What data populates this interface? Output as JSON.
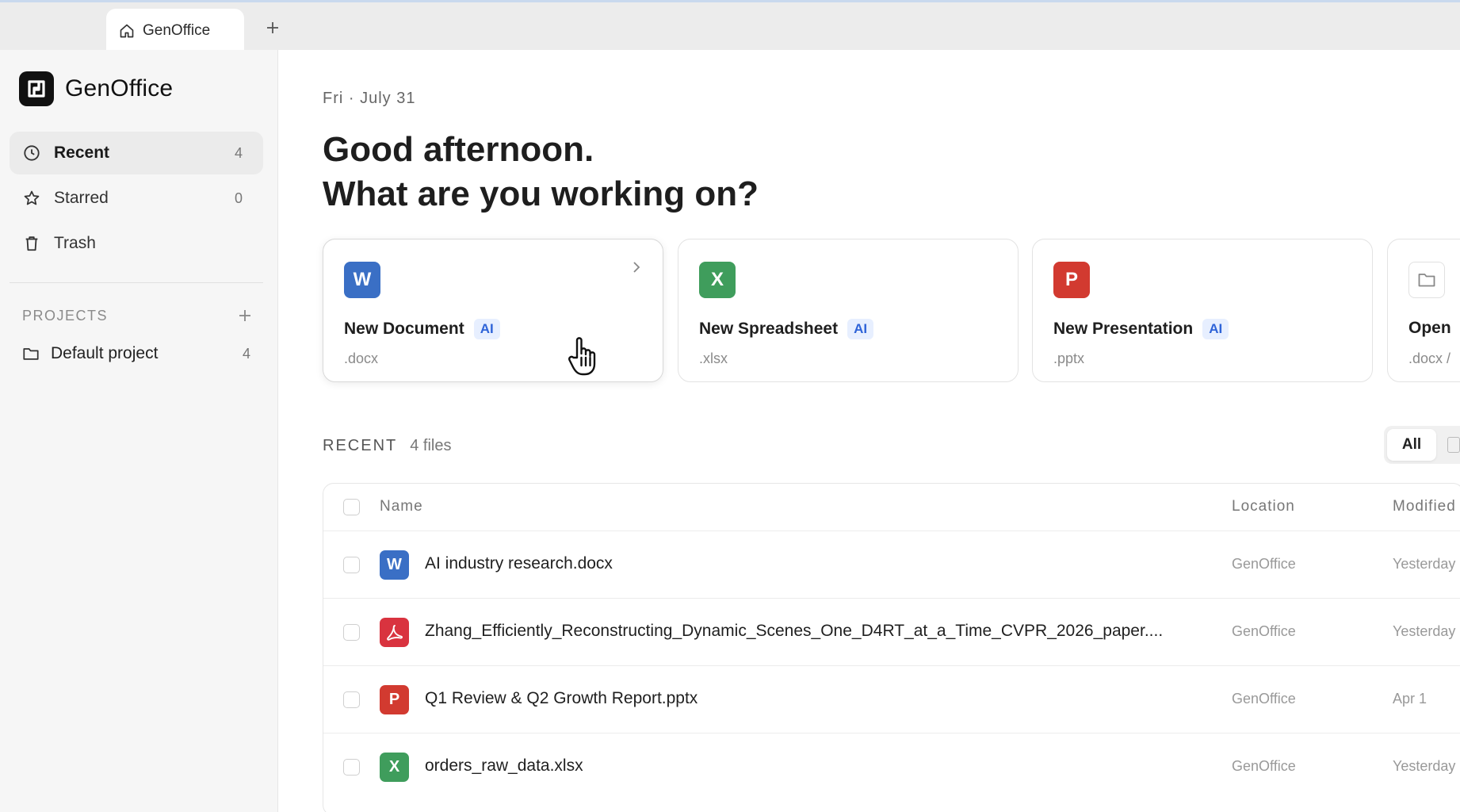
{
  "tab": {
    "title": "GenOffice"
  },
  "sidebar": {
    "brand": "GenOffice",
    "nav": [
      {
        "label": "Recent",
        "count": "4"
      },
      {
        "label": "Starred",
        "count": "0"
      },
      {
        "label": "Trash",
        "count": ""
      }
    ],
    "projects_header": "PROJECTS",
    "projects": [
      {
        "label": "Default project",
        "count": "4"
      }
    ]
  },
  "main": {
    "date": "Fri · July 31",
    "greeting_line1": "Good afternoon.",
    "greeting_line2": "What are you working on?",
    "cards": [
      {
        "badge": "W",
        "title": "New Document",
        "tag": "AI",
        "ext": ".docx"
      },
      {
        "badge": "X",
        "title": "New Spreadsheet",
        "tag": "AI",
        "ext": ".xlsx"
      },
      {
        "badge": "P",
        "title": "New Presentation",
        "tag": "AI",
        "ext": ".pptx"
      },
      {
        "badge": "",
        "title": "Open",
        "tag": "",
        "ext": ".docx /"
      }
    ],
    "recent": {
      "title": "RECENT",
      "count": "4 files",
      "filter_all": "All",
      "columns": {
        "name": "Name",
        "location": "Location",
        "modified": "Modified"
      },
      "files": [
        {
          "badge": "W",
          "name": "AI industry research.docx",
          "location": "GenOffice",
          "modified": "Yesterday"
        },
        {
          "badge": "pdf",
          "name": "Zhang_Efficiently_Reconstructing_Dynamic_Scenes_One_D4RT_at_a_Time_CVPR_2026_paper....",
          "location": "GenOffice",
          "modified": "Yesterday"
        },
        {
          "badge": "P",
          "name": "Q1 Review & Q2 Growth Report.pptx",
          "location": "GenOffice",
          "modified": "Apr 1"
        },
        {
          "badge": "X",
          "name": "orders_raw_data.xlsx",
          "location": "GenOffice",
          "modified": "Yesterday"
        }
      ]
    }
  },
  "colors": {
    "word": "#3a6fc5",
    "excel": "#3f9d5c",
    "powerpoint": "#d23a30",
    "pdf": "#d9333f",
    "ai_tag": "#2f64d8"
  }
}
